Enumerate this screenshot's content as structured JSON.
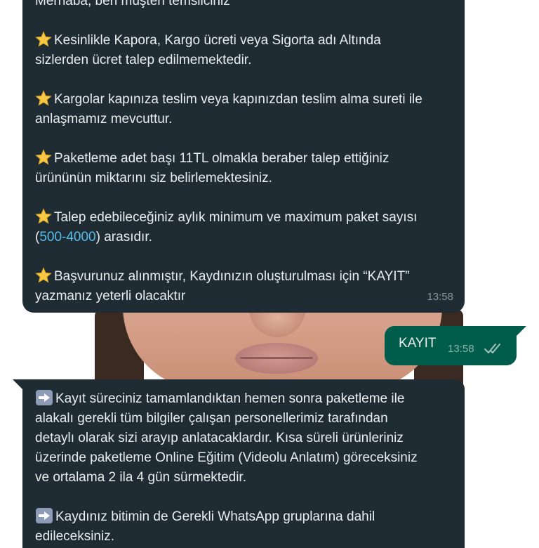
{
  "messages": {
    "incoming_1": {
      "top_line": "Merhaba, ben müşteri temsilciniz",
      "paragraphs": [
        {
          "icon": "star-emoji",
          "lines": [
            "Kesinlikle Kapora, Kargo ücreti veya Sigorta adı Altında",
            "sizlerden ücret talep edilmemektedir."
          ]
        },
        {
          "icon": "star-emoji",
          "lines": [
            "Kargolar kapınıza teslim veya kapınızdan teslim alma sureti ile",
            "anlaşmamız mevcuttur."
          ]
        },
        {
          "icon": "star-emoji",
          "lines": [
            "Paketleme adet başı 11TL olmakla beraber talep ettiğiniz",
            "ürününün miktarını siz belirlemektesiniz."
          ]
        },
        {
          "icon": "star-emoji",
          "lines": [
            "Talep edebileceğiniz aylık minimum ve maximum paket sayısı"
          ],
          "line2_prefix": "(",
          "line2_link": "500-4000",
          "line2_suffix": ") arasıdır."
        },
        {
          "icon": "star-emoji",
          "lines": [
            "Başvurunuz alınmıştır, Kaydınızın oluşturulması için “KAYIT”",
            "yazmanız yeterli olacaktır"
          ]
        }
      ],
      "time": "13:58"
    },
    "outgoing": {
      "text": "KAYIT",
      "time": "13:58",
      "status_icon": "double-check-icon"
    },
    "incoming_2": {
      "paragraphs": [
        {
          "icon": "right-arrow-emoji",
          "lines": [
            "Kayıt süreciniz tamamlandıktan hemen sonra paketleme ile",
            "alakalı gerekli tüm bilgiler çalışan personellerimiz tarafından",
            "detaylı olarak sizi arayıp anlatacaklardır. Kısa süreli ürünleriniz",
            "üzerinde paketleme Online Eğitim (Videolu Anlatım) göreceksiniz",
            "ve ortalama 2 ila 4 gün sürmektedir."
          ]
        },
        {
          "icon": "right-arrow-emoji",
          "lines": [
            "Kaydınız bitimin de Gerekli WhatsApp gruplarına dahil",
            "edileceksiniz."
          ]
        }
      ]
    }
  },
  "colors": {
    "incoming_bubble": "#1f2c33",
    "outgoing_bubble": "#005c4b",
    "link": "#53bdeb",
    "text": "#e9edef"
  }
}
